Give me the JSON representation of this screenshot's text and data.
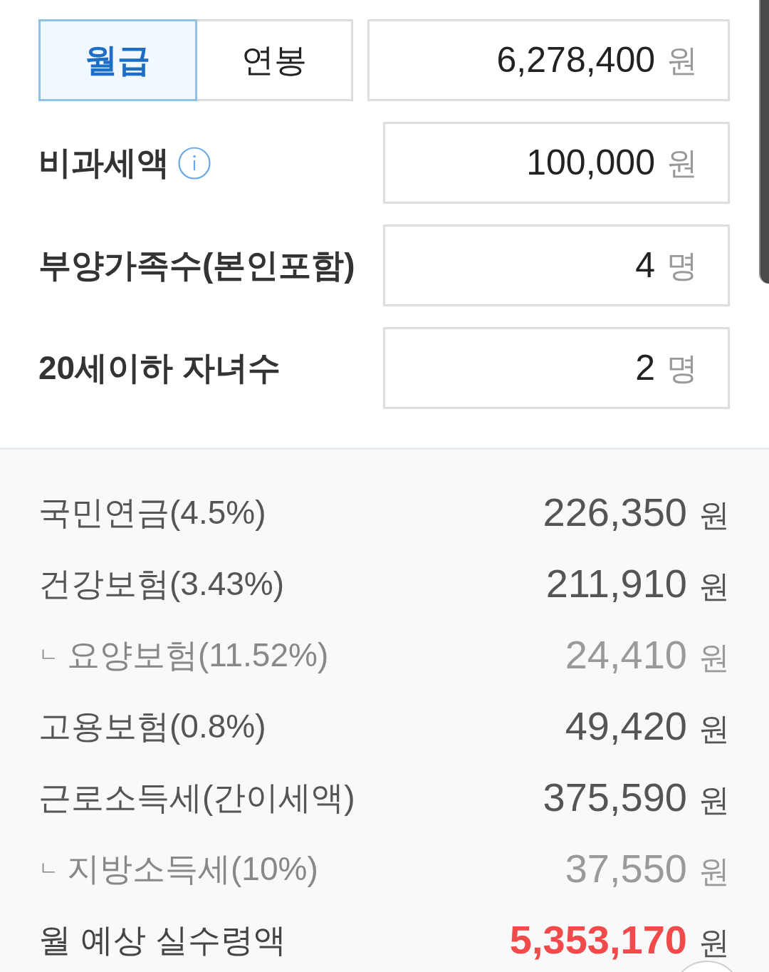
{
  "pay_type_tabs": [
    {
      "label": "월급",
      "selected": true
    },
    {
      "label": "연봉",
      "selected": false
    }
  ],
  "salary_field": {
    "value": "6,278,400",
    "unit": "원"
  },
  "inputs": [
    {
      "label": "비과세액",
      "info": true,
      "value": "100,000",
      "unit": "원"
    },
    {
      "label": "부양가족수(본인포함)",
      "info": false,
      "value": "4",
      "unit": "명"
    },
    {
      "label": "20세이하 자녀수",
      "info": false,
      "value": "2",
      "unit": "명"
    }
  ],
  "results": [
    {
      "kind": "main",
      "label": "국민연금(4.5%)",
      "amount": "226,350",
      "unit": "원"
    },
    {
      "kind": "main",
      "label": "건강보험(3.43%)",
      "amount": "211,910",
      "unit": "원"
    },
    {
      "kind": "sub",
      "marker": "ㄴ",
      "label": "요양보험(11.52%)",
      "amount": "24,410",
      "unit": "원"
    },
    {
      "kind": "main",
      "label": "고용보험(0.8%)",
      "amount": "49,420",
      "unit": "원"
    },
    {
      "kind": "main",
      "label": "근로소득세(간이세액)",
      "amount": "375,590",
      "unit": "원"
    },
    {
      "kind": "sub",
      "marker": "ㄴ",
      "label": "지방소득세(10%)",
      "amount": "37,550",
      "unit": "원"
    },
    {
      "kind": "total",
      "label": "월 예상 실수령액",
      "amount": "5,353,170",
      "unit": "원"
    }
  ]
}
